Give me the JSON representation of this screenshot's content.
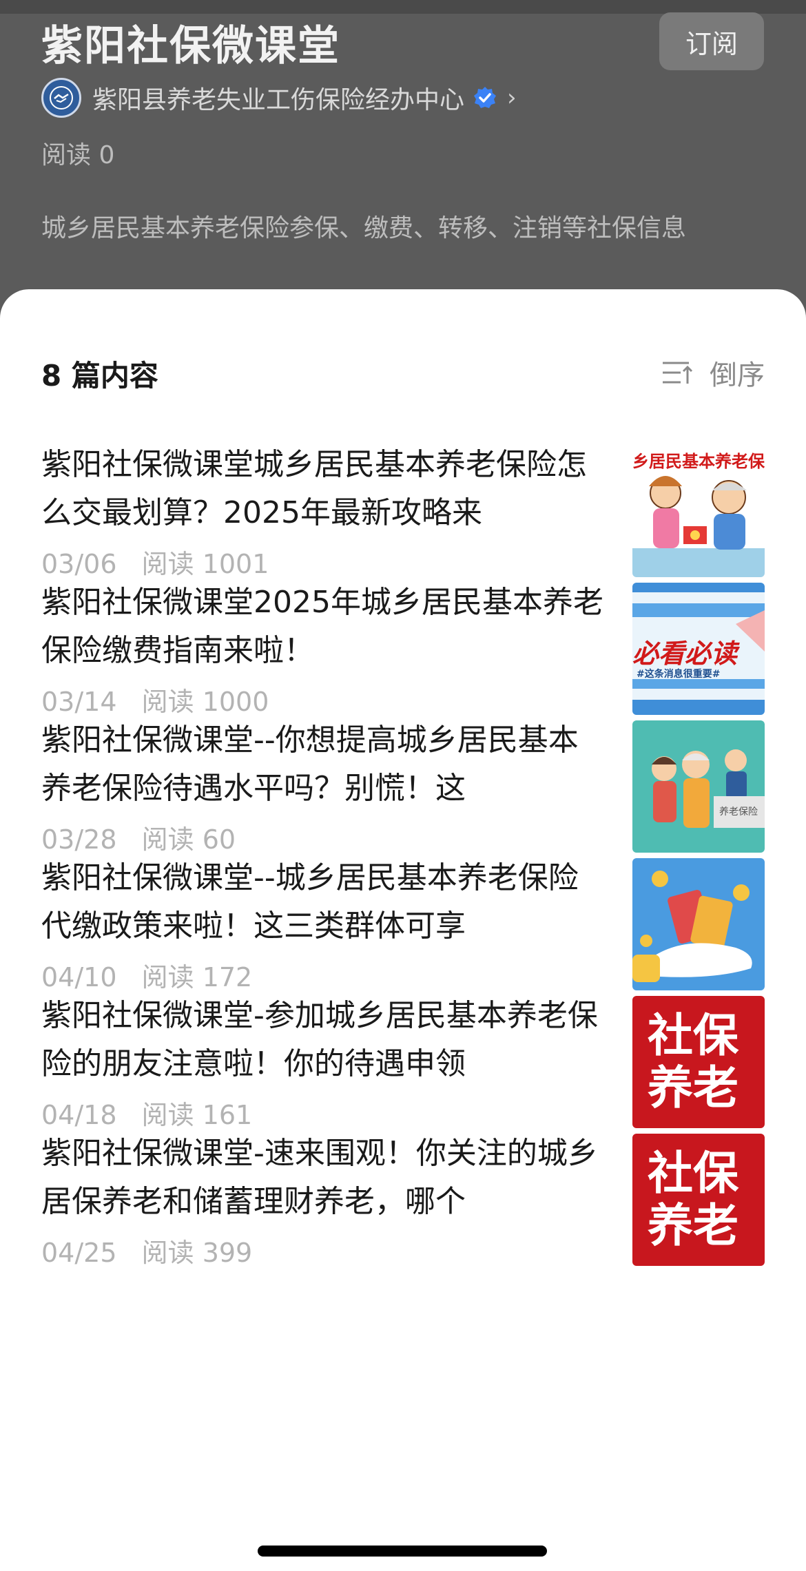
{
  "header": {
    "title": "紫阳社保微课堂",
    "subscribe_label": "订阅",
    "account_name": "紫阳县养老失业工伤保险经办中心",
    "reads_label": "阅读 0",
    "description": "城乡居民基本养老保险参保、缴费、转移、注销等社保信息"
  },
  "list": {
    "count_label": "8 篇内容",
    "sort_label": "倒序",
    "articles": [
      {
        "title": "紫阳社保微课堂城乡居民基本养老保险怎么交最划算？2025年最新攻略来",
        "date": "03/06",
        "reads": "阅读 1001",
        "thumb_text": "乡居民基本养老保"
      },
      {
        "title": "紫阳社保微课堂2025年城乡居民基本养老保险缴费指南来啦！",
        "date": "03/14",
        "reads": "阅读 1000",
        "thumb_text": "必看必读",
        "thumb_sub": "#这条消息很重要#"
      },
      {
        "title": "紫阳社保微课堂--你想提高城乡居民基本养老保险待遇水平吗？别慌！这",
        "date": "03/28",
        "reads": "阅读 60",
        "thumb_text": "养老保险"
      },
      {
        "title": "紫阳社保微课堂--城乡居民基本养老保险代缴政策来啦！这三类群体可享",
        "date": "04/10",
        "reads": "阅读 172",
        "thumb_text": ""
      },
      {
        "title": "紫阳社保微课堂-参加城乡居民基本养老保险的朋友注意啦！你的待遇申领",
        "date": "04/18",
        "reads": "阅读 161",
        "thumb_text": "社保养老"
      },
      {
        "title": "紫阳社保微课堂-速来围观！你关注的城乡居保养老和储蓄理财养老，哪个",
        "date": "04/25",
        "reads": "阅读 399",
        "thumb_text": "社保养老"
      }
    ]
  },
  "colors": {
    "header_bg": "#5b5b5b",
    "verified_blue": "#3b82f6",
    "thumb_red": "#c8171e",
    "thumb_teal": "#4fbcb2",
    "thumb_blue": "#3f8ed8"
  }
}
